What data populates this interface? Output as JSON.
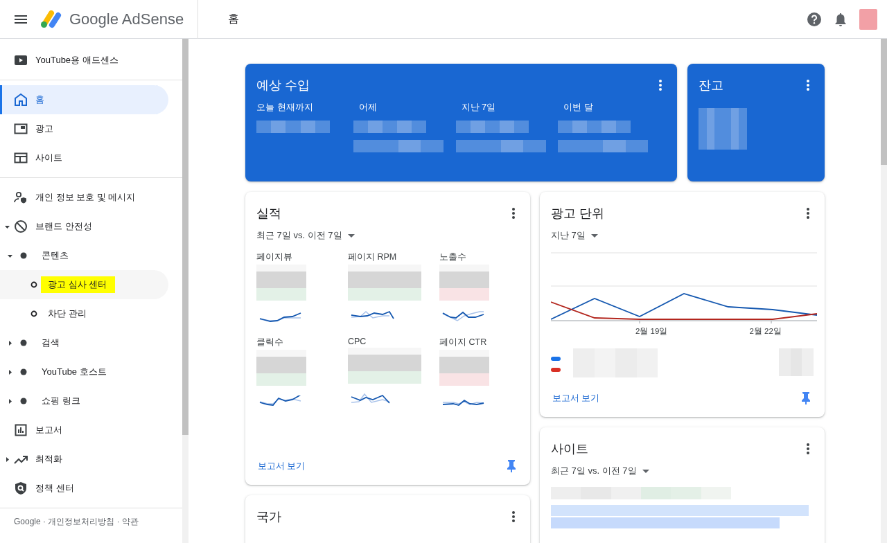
{
  "header": {
    "product": "Google AdSense",
    "page_title": "홈"
  },
  "sidebar": {
    "groups": [
      [
        {
          "label": "YouTube용 애드센스",
          "selected": false
        }
      ],
      [
        {
          "label": "홈",
          "selected": true
        },
        {
          "label": "광고",
          "selected": false
        },
        {
          "label": "사이트",
          "selected": false
        }
      ],
      [
        {
          "label": "개인 정보 보호 및 메시지",
          "selected": false
        },
        {
          "label": "브랜드 안전성",
          "selected": false,
          "expanded": true,
          "children": [
            {
              "label": "콘텐츠",
              "selected": false,
              "expanded": true,
              "children": [
                {
                  "label": "광고 심사 센터",
                  "selected": false,
                  "highlighted": true
                },
                {
                  "label": "차단 관리",
                  "selected": false,
                  "highlighted": false
                }
              ]
            },
            {
              "label": "검색",
              "selected": false,
              "expanded": false
            },
            {
              "label": "YouTube 호스트",
              "selected": false,
              "expanded": false
            },
            {
              "label": "쇼핑 링크",
              "selected": false,
              "expanded": false
            }
          ]
        },
        {
          "label": "보고서",
          "selected": false
        },
        {
          "label": "최적화",
          "selected": false,
          "expanded": false
        },
        {
          "label": "정책 센터",
          "selected": false
        }
      ]
    ],
    "footer": "Google · 개인정보처리방침 · 약관"
  },
  "earnings_card": {
    "title": "예상 수입",
    "columns": [
      "오늘 현재까지",
      "어제",
      "지난 7일",
      "이번 달"
    ]
  },
  "balance_card": {
    "title": "잔고"
  },
  "performance_card": {
    "title": "실적",
    "period": "최근 7일 vs. 이전 7일",
    "metrics": [
      {
        "label": "페이지뷰",
        "color": "#e3f1e7"
      },
      {
        "label": "페이지 RPM",
        "color": "#e3f1e7"
      },
      {
        "label": "노출수",
        "color": "#f9e3e5"
      },
      {
        "label": "클릭수",
        "color": "#e3f1e7"
      },
      {
        "label": "CPC",
        "color": "#e3f1e7"
      },
      {
        "label": "페이지 CTR",
        "color": "#f9e3e5"
      }
    ],
    "link": "보고서 보기"
  },
  "ad_units_card": {
    "title": "광고 단위",
    "period": "지난 7일",
    "x_labels": [
      "2월 19일",
      "2월 22일"
    ],
    "legend": [
      {
        "color": "#1a73e8"
      },
      {
        "color": "#d93025"
      }
    ],
    "link": "보고서 보기"
  },
  "sites_card": {
    "title": "사이트",
    "period": "최근 7일 vs. 이전 7일"
  },
  "country_card": {
    "title": "국가"
  }
}
